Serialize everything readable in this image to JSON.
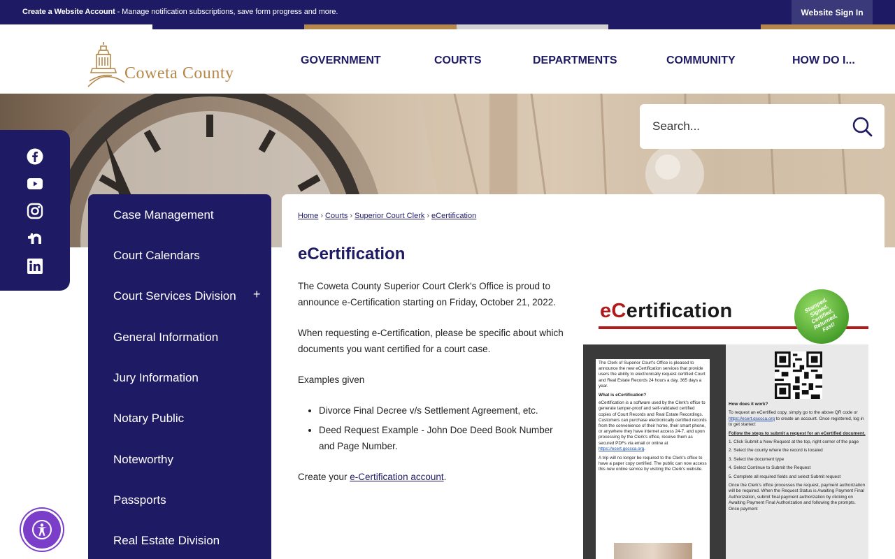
{
  "topbar": {
    "message_bold": "Create a Website Account",
    "message_rest": " - Manage notification subscriptions, save form progress and more.",
    "signin_label": "Website Sign In"
  },
  "logo": {
    "text": "Coweta County"
  },
  "nav": {
    "items": [
      "GOVERNMENT",
      "COURTS",
      "DEPARTMENTS",
      "COMMUNITY",
      "HOW DO I..."
    ]
  },
  "search": {
    "placeholder": "Search..."
  },
  "social": {
    "icons": [
      "facebook-icon",
      "youtube-icon",
      "instagram-icon",
      "nextdoor-icon",
      "linkedin-icon"
    ]
  },
  "sidebar": {
    "items": [
      {
        "label": "Case Management"
      },
      {
        "label": "Court Calendars"
      },
      {
        "label": "Court Services Division",
        "expand": "+"
      },
      {
        "label": "General Information"
      },
      {
        "label": "Jury Information"
      },
      {
        "label": "Notary Public"
      },
      {
        "label": "Noteworthy"
      },
      {
        "label": "Passports"
      },
      {
        "label": "Real Estate Division"
      }
    ]
  },
  "breadcrumb": [
    "Home",
    "Courts",
    "Superior Court Clerk",
    "eCertification"
  ],
  "page": {
    "title": "eCertification",
    "p1": "The Coweta County Superior Court Clerk's Office is proud to announce e-Certification starting on Friday, October 21, 2022.",
    "p2": "When requesting e-Certification, please be specific about which documents you want certified for a court case.",
    "p3": "Examples given",
    "list": [
      "Divorce Final Decree v/s Settlement Agreement, etc.",
      "Deed Request Example - John Doe Deed Book Number and Page Number."
    ],
    "p4_before": "Create your ",
    "p4_link": "e-Certification account",
    "p4_after": "."
  },
  "flyer": {
    "heading_e": "eC",
    "heading_rest": "ertification",
    "badge": "Stamped, Signed, Certified, Returned, Fast!",
    "left_intro": "The Clerk of Superior Court's Office is pleased to announce the new eCertification services that provide users the ability to electronically request certified Court and Real Estate Records 24 hours a day, 365 days a year.",
    "left_heading": "What is eCertification?",
    "left_body": "eCertification is a software used by the Clerk's office to generate tamper-proof and self-validated certified copies of Court Records and Real Estate Recordings. Customers can purchase electronically certified records from the convenience of their home, their smart phone, or anywhere they have internet access 24-7, and upon processing by the Clerk's office, receive them as secured PDFs via email or online at",
    "left_link": "https://ecert.gsccca.org",
    "left_trip": "A trip will no longer be required to the Clerk's office to have a paper copy certified. The public can now access this new online service by visiting the Clerk's website.",
    "right_heading": "How does it work?",
    "right_intro_a": "To request an eCertified copy, simply go to the above QR code or",
    "right_link": "https://ecert.gsccca.org",
    "right_intro_b": "to create an account. Once registered, log in to get started:",
    "right_steps_heading": "Follow the steps to submit a request for an eCertified document.",
    "right_steps": [
      "1.  Click Submit a New Request at the top, right corner of the page",
      "2.  Select the county where the record is located",
      "3.  Select the document type",
      "4.  Select Continue to Submit the Request",
      "5.  Complete all required fields and select Submit request"
    ],
    "right_outro": "Once the Clerk's office processes the request, payment authorization will be required. When the Request Status is Awaiting Payment Final Authorization, submit final payment authorization by clicking on Awaiting Payment Final Authorization and following the prompts. Once payment"
  },
  "colors": {
    "navy": "#1e1a64",
    "gold": "#b5874a",
    "red": "#b01a1a",
    "purple": "#7a3ec8"
  }
}
